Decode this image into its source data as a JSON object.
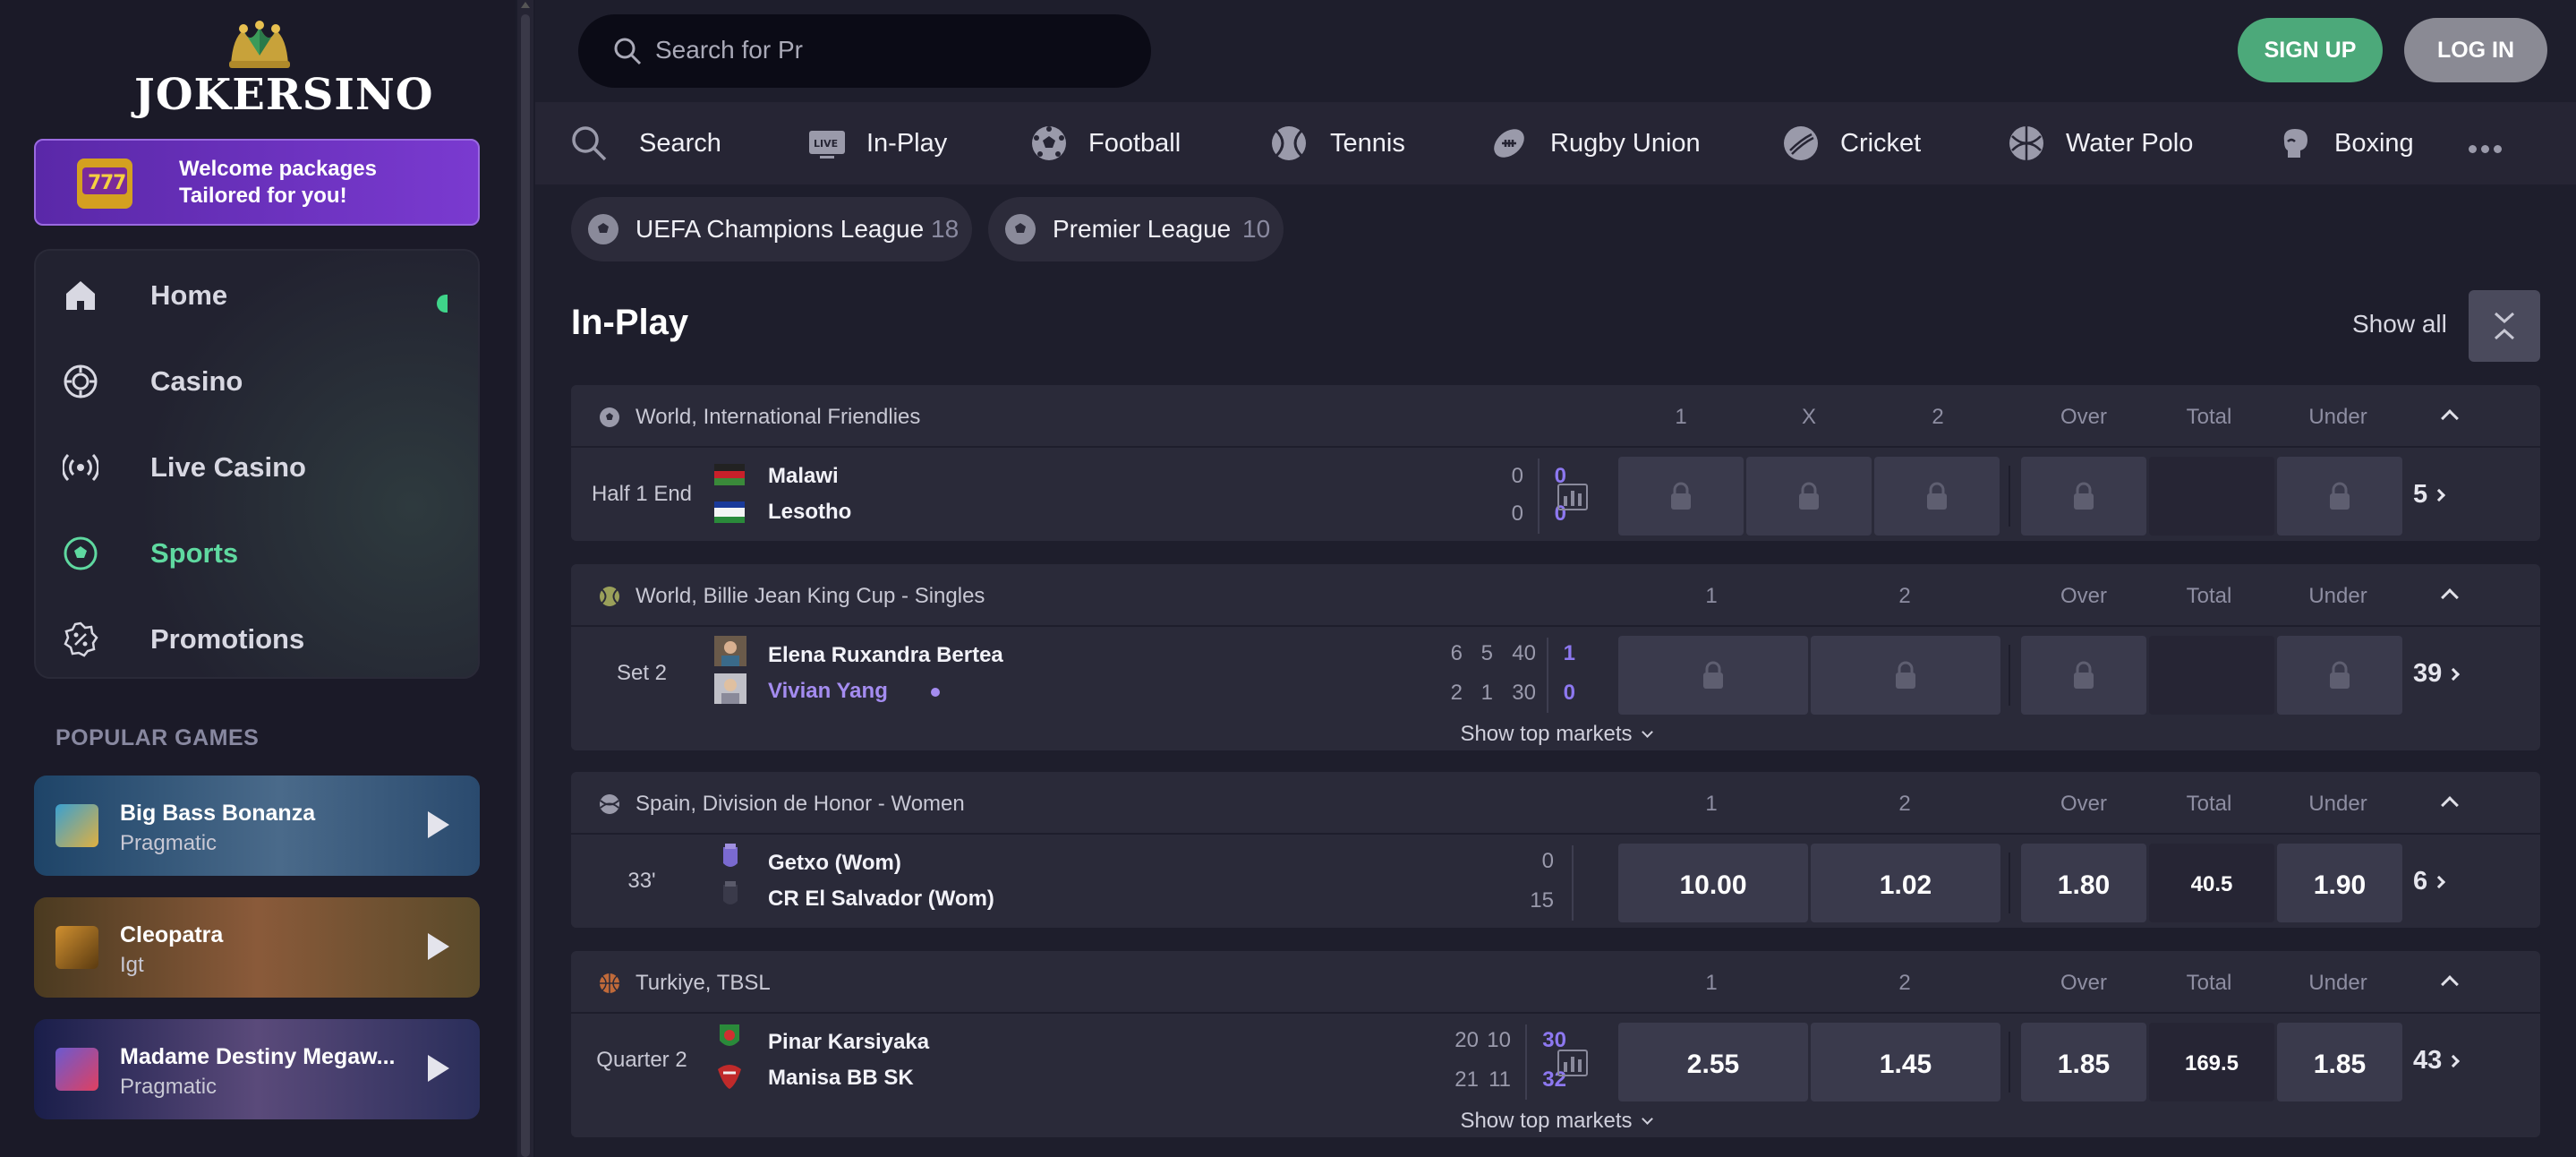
{
  "brand": {
    "name": "JOKERSINO"
  },
  "welcome": {
    "line1": "Welcome packages",
    "line2": "Tailored for you!"
  },
  "nav": [
    {
      "label": "Home",
      "icon": "home-icon",
      "active": false
    },
    {
      "label": "Casino",
      "icon": "chip-icon",
      "active": false
    },
    {
      "label": "Live Casino",
      "icon": "live-broadcast-icon",
      "active": false
    },
    {
      "label": "Sports",
      "icon": "soccer-ball-icon",
      "active": true
    },
    {
      "label": "Promotions",
      "icon": "percent-badge-icon",
      "active": false
    }
  ],
  "popular": {
    "title": "POPULAR GAMES",
    "games": [
      {
        "name": "Big Bass Bonanza",
        "provider": "Pragmatic"
      },
      {
        "name": "Cleopatra",
        "provider": "Igt"
      },
      {
        "name": "Madame Destiny Megaw...",
        "provider": "Pragmatic"
      }
    ]
  },
  "header": {
    "search_placeholder": "Search for Pr",
    "signup": "SIGN UP",
    "login": "LOG IN"
  },
  "sports": [
    {
      "label": "Search",
      "icon": "search-icon"
    },
    {
      "label": "In-Play",
      "icon": "live-tv-icon"
    },
    {
      "label": "Football",
      "icon": "football-icon"
    },
    {
      "label": "Tennis",
      "icon": "tennis-icon"
    },
    {
      "label": "Rugby Union",
      "icon": "rugby-icon"
    },
    {
      "label": "Cricket",
      "icon": "cricket-icon"
    },
    {
      "label": "Water Polo",
      "icon": "water-polo-icon"
    },
    {
      "label": "Boxing",
      "icon": "boxing-glove-icon"
    }
  ],
  "chips": [
    {
      "label": "UEFA Champions League",
      "count": "18"
    },
    {
      "label": "Premier League",
      "count": "10"
    }
  ],
  "section": {
    "title": "In-Play",
    "show_all": "Show all",
    "show_top_markets": "Show top markets"
  },
  "leagues": [
    {
      "name": "World, International Friendlies",
      "cols": [
        "1",
        "X",
        "2",
        "Over",
        "Total",
        "Under"
      ],
      "status": "Half 1 End",
      "team1": "Malawi",
      "team2": "Lesotho",
      "scores1": [
        "0",
        "0"
      ],
      "scores2": [
        "0",
        "0"
      ],
      "more": "5"
    },
    {
      "name": "World, Billie Jean King Cup - Singles",
      "cols": [
        "1",
        "2",
        "Over",
        "Total",
        "Under"
      ],
      "status": "Set 2",
      "team1": "Elena Ruxandra Bertea",
      "team2": "Vivian Yang",
      "scores1": [
        "6",
        "5",
        "40",
        "1"
      ],
      "scores2": [
        "2",
        "1",
        "30",
        "0"
      ],
      "more": "39"
    },
    {
      "name": "Spain, Division de Honor - Women",
      "cols": [
        "1",
        "2",
        "Over",
        "Total",
        "Under"
      ],
      "status": "33'",
      "team1": "Getxo (Wom)",
      "team2": "CR El Salvador (Wom)",
      "scores1": [
        "0"
      ],
      "scores2": [
        "15"
      ],
      "odds": [
        "10.00",
        "1.02",
        "1.80",
        "40.5",
        "1.90"
      ],
      "more": "6"
    },
    {
      "name": "Turkiye, TBSL",
      "cols": [
        "1",
        "2",
        "Over",
        "Total",
        "Under"
      ],
      "status": "Quarter 2",
      "team1": "Pinar Karsiyaka",
      "team2": "Manisa BB SK",
      "scores1": [
        "20",
        "10",
        "30"
      ],
      "scores2": [
        "21",
        "11",
        "32"
      ],
      "odds": [
        "2.55",
        "1.45",
        "1.85",
        "169.5",
        "1.85"
      ],
      "more": "43"
    }
  ]
}
